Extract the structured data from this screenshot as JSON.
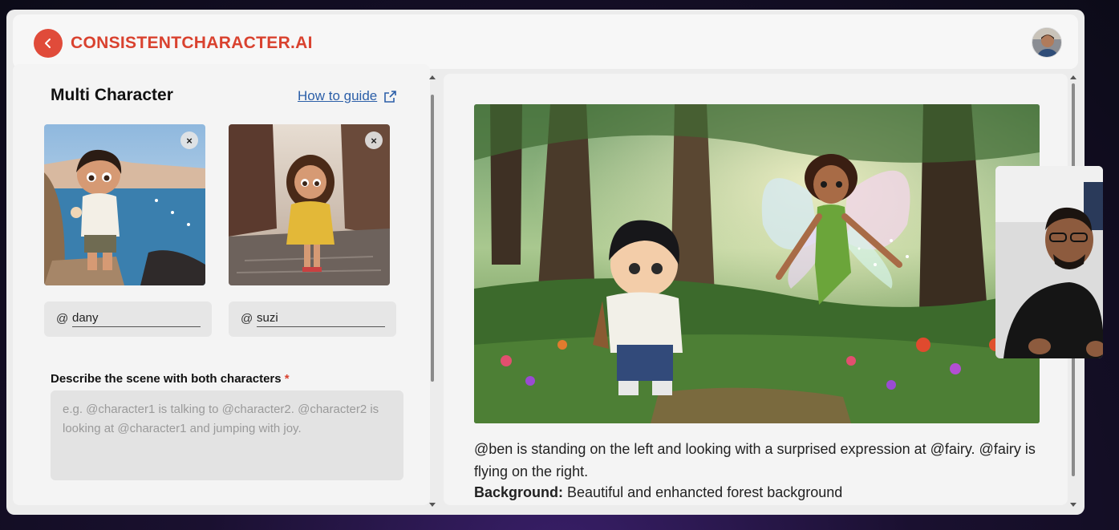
{
  "header": {
    "brand": "CONSISTENTCHARACTER.AI",
    "back_icon": "chevron-left-icon",
    "accent_color": "#d9422f"
  },
  "left_panel": {
    "title": "Multi Character",
    "guide_link": "How to guide",
    "guide_icon": "external-link-icon",
    "characters": [
      {
        "tag_prefix": "@",
        "tag": "dany",
        "close": "×"
      },
      {
        "tag_prefix": "@",
        "tag": "suzi",
        "close": "×"
      }
    ],
    "describe_label": "Describe the scene with both characters",
    "required_mark": "*",
    "scene_placeholder": "e.g. @character1 is talking to @character2. @character2 is looking at @character1 and jumping with joy."
  },
  "right_panel": {
    "caption": "@ben is standing on the left and looking with a surprised expression at @fairy. @fairy is flying on the right.",
    "background_label": "Background:",
    "background_text": "Beautiful and enhancted forest background"
  }
}
